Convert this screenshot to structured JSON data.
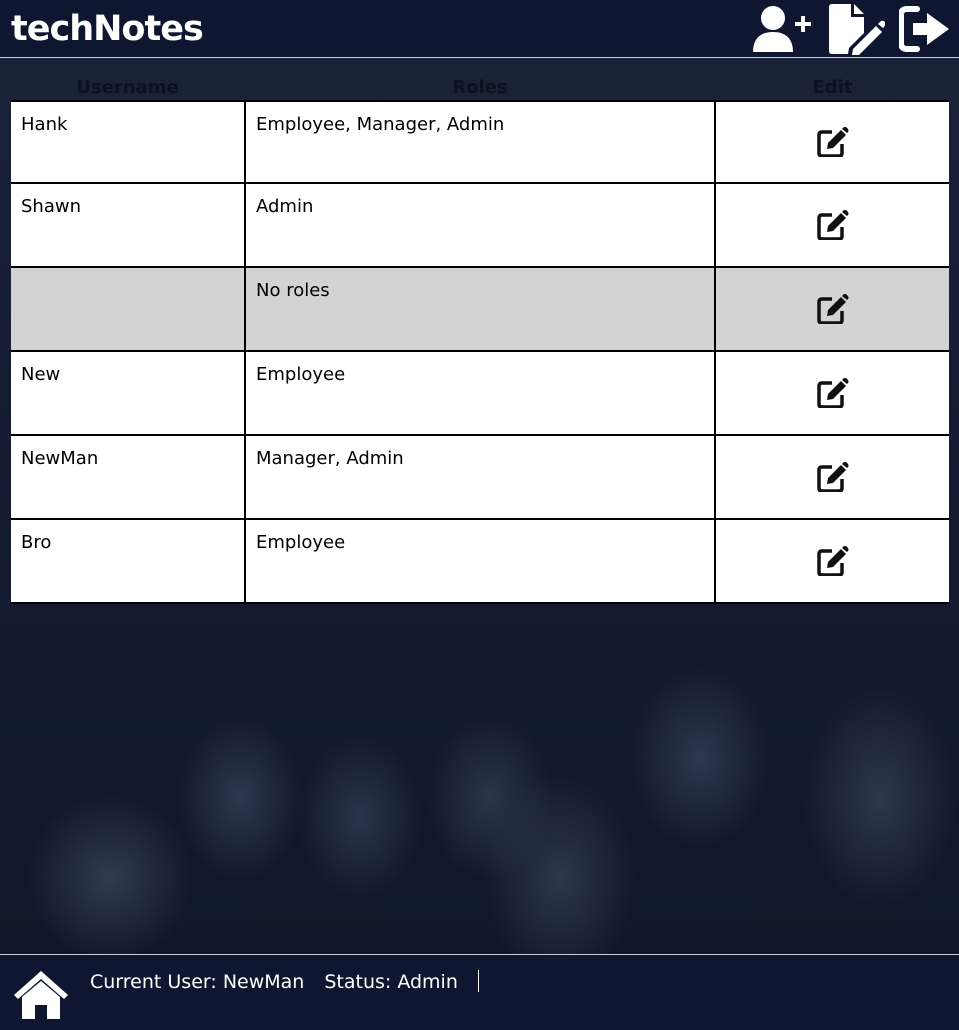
{
  "app": {
    "title": "techNotes"
  },
  "header": {
    "icons": [
      "add-user-icon",
      "new-note-icon",
      "logout-icon"
    ]
  },
  "table": {
    "columns": [
      "Username",
      "Roles",
      "Edit"
    ],
    "rows": [
      {
        "username": "Hank",
        "roles": "Employee, Manager, Admin",
        "active": true
      },
      {
        "username": "Shawn",
        "roles": "Admin",
        "active": true
      },
      {
        "username": "",
        "roles": "No roles",
        "active": false
      },
      {
        "username": "New",
        "roles": "Employee",
        "active": true
      },
      {
        "username": "NewMan",
        "roles": "Manager, Admin",
        "active": true
      },
      {
        "username": "Bro",
        "roles": "Employee",
        "active": true
      }
    ]
  },
  "footer": {
    "current_user": "Current User: NewMan",
    "status": "Status: Admin"
  },
  "colors": {
    "navy": "#0f1730",
    "inactive_row": "#d3d3d3",
    "cell": "#ffffff"
  }
}
